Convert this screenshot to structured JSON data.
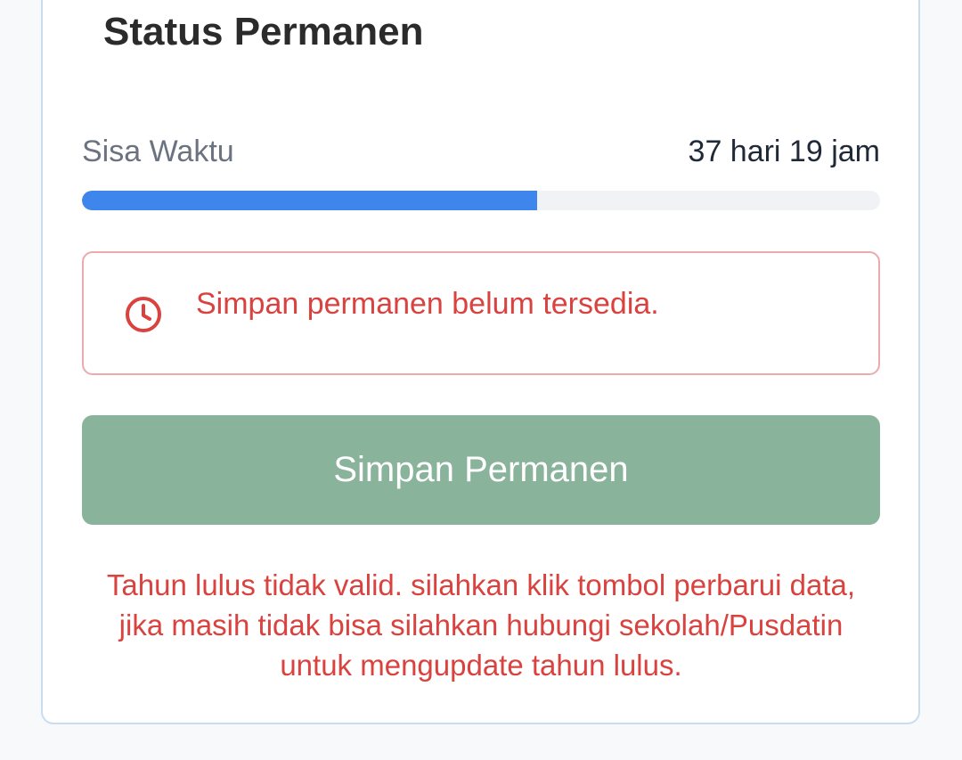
{
  "card": {
    "title": "Status Permanen"
  },
  "time_remaining": {
    "label": "Sisa Waktu",
    "value": "37 hari 19 jam",
    "progress_percent": 57,
    "progress_color": "#3f86ec"
  },
  "alert": {
    "icon": "clock-icon",
    "message": "Simpan permanen belum tersedia.",
    "color": "#d9423e"
  },
  "primary_button": {
    "label": "Simpan Permanen",
    "color": "#8ab39c"
  },
  "error_message": {
    "text": "Tahun lulus tidak valid. silahkan klik tombol perbarui data, jika masih tidak bisa silahkan hubungi sekolah/Pusdatin untuk mengupdate tahun lulus.",
    "color": "#d9423e"
  }
}
